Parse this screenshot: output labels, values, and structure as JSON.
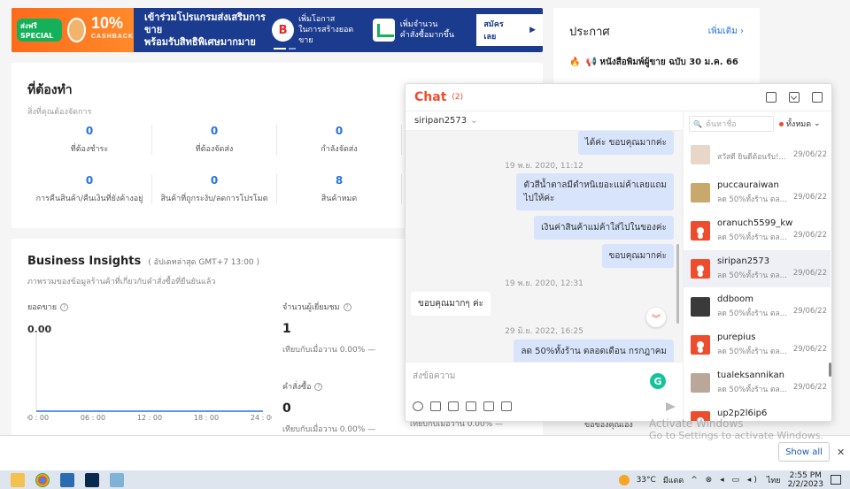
{
  "banner": {
    "special": "ส่งฟรี SPECIAL",
    "cashback_pct": "10%",
    "cashback_label": "CASHBACK",
    "headline1": "เข้าร่วมโปรแกรมส่งเสริมการขาย",
    "headline2": "พร้อมรับสิทธิพิเศษมากมาย",
    "badge": "B",
    "benefit1a": "เพิ่มโอกาส",
    "benefit1b": "ในการสร้างยอดขาย",
    "benefit2a": "เพิ่มจำนวน",
    "benefit2b": "คำสั่งซื้อมากขึ้น",
    "cta": "สมัครเลย",
    "cta_arrow": "▶"
  },
  "announce": {
    "title": "ประกาศ",
    "more": "เพิ่มเติม",
    "chevron": "›",
    "item": "📢 หนังสือพิมพ์ผู้ขาย ฉบับ 30 ม.ค. 66",
    "fire": "🔥"
  },
  "todo": {
    "title": "ที่ต้องทำ",
    "subtitle": "สิ่งที่คุณต้องจัดการ",
    "cells": [
      {
        "num": "0",
        "label": "ที่ต้องชำระ"
      },
      {
        "num": "0",
        "label": "ที่ต้องจัดส่ง"
      },
      {
        "num": "0",
        "label": "กำลังจัดส่ง"
      },
      {
        "num": "0",
        "label": "การคืนสินค้า/คืนเงินที่ยังค้างอยู่"
      },
      {
        "num": "0",
        "label": "สินค้าที่ถูกระงับ/ลดการโปรโมต"
      },
      {
        "num": "8",
        "label": "สินค้าหมด"
      }
    ]
  },
  "insights": {
    "title": "Business Insights",
    "updated": "( อัปเดทล่าสุด GMT+7 13:00 )",
    "subtitle": "ภาพรวมของข้อมูลร้านค้าที่เกี่ยวกับคำสั่งซื้อที่ยืนยันแล้ว",
    "sales_label": "ยอดขาย",
    "sales_value": "0.00",
    "visitors_label": "จำนวนผู้เยี่ยมชม",
    "visitors_value": "1",
    "visitors_cmp": "เทียบกับเมื่อวาน 0.00% —",
    "orders_label": "คำสั่งซื้อ",
    "orders_value": "0",
    "orders_cmp": "เทียบกับเมื่อวาน 0.00% —",
    "cmp3": "เทียบกับเมื่อวาน 0.00% —",
    "help": "?",
    "x_ticks": [
      "00 : 00",
      "06 : 00",
      "12 : 00",
      "18 : 00",
      "24 : 00"
    ]
  },
  "chart_data": {
    "type": "line",
    "x": [
      "00:00",
      "06:00",
      "12:00",
      "18:00",
      "24:00"
    ],
    "values": [
      0,
      0,
      0,
      0,
      0
    ],
    "ylim": [
      0,
      1
    ],
    "color": "#2673dd"
  },
  "chat": {
    "title": "Chat",
    "count": "(2)",
    "current_user": "siripan2573",
    "user_chevron": "⌄",
    "messages": {
      "m0": "ได้ค่ะ ขอบคุณมากค่ะ",
      "ts1": "19 พ.ย. 2020, 11:12",
      "m1a": "ตัวสีน้ำตาลมีตำหนิเยอะแม่ค้าเลยแถม",
      "m1b": "ไปให้ค่ะ",
      "m2": "เงินค่าสินค้าแม่ค้าใส่ไปในของค่ะ",
      "m3": "ขอบคุณมากค่ะ",
      "ts2": "19 พ.ย. 2020, 12:31",
      "m4": "ขอบคุณมากๆ ค่ะ",
      "ts3": "29 มิ.ย. 2022, 16:25",
      "m5": "ลด 50%ทั้งร้าน ตลอดเดือน กรกฎาคม"
    },
    "scroll_down": "︾",
    "input_placeholder": "ส่งข้อความ",
    "grammar": "G",
    "search_placeholder": "ค้นหาชื่อ",
    "search_icon": "🔍",
    "filter": "ทั้งหมด",
    "filter_chevron": "⌄",
    "contacts": [
      {
        "name": "",
        "preview": "สวัสดี ยินดีต้อนรับ!...",
        "date": "29/06/22",
        "avatar": "#e8d6c8"
      },
      {
        "name": "puccauraiwan",
        "preview": "ลด 50%ทั้งร้าน ตล...",
        "date": "29/06/22",
        "avatar": "#c9a86b"
      },
      {
        "name": "oranuch5599_kw",
        "preview": "ลด 50%ทั้งร้าน ตล...",
        "date": "29/06/22",
        "avatar": "default"
      },
      {
        "name": "siripan2573",
        "preview": "ลด 50%ทั้งร้าน ตล...",
        "date": "29/06/22",
        "avatar": "default"
      },
      {
        "name": "ddboom",
        "preview": "ลด 50%ทั้งร้าน ตล...",
        "date": "29/06/22",
        "avatar": "#3a3a3a"
      },
      {
        "name": "purepius",
        "preview": "ลด 50%ทั้งร้าน ตล...",
        "date": "29/06/22",
        "avatar": "default"
      },
      {
        "name": "tualeksannikan",
        "preview": "ลด 50%ทั้งร้าน ตล...",
        "date": "29/06/22",
        "avatar": "#b9a89a"
      },
      {
        "name": "up2p2l6ip6",
        "preview": "ลด 50%ทั้งร้าน ตล...",
        "date": "29/06/22",
        "avatar": "default"
      }
    ]
  },
  "windows": {
    "activate_title": "Activate Windows",
    "activate_sub": "Go to Settings to activate Windows.",
    "partial": "ขอของคุณเอง",
    "show_all": "Show all",
    "close": "✕",
    "temp": "33°C",
    "weather": "มีแดด",
    "lang": "ไทย",
    "time": "2:55 PM",
    "date": "2/2/2023"
  }
}
